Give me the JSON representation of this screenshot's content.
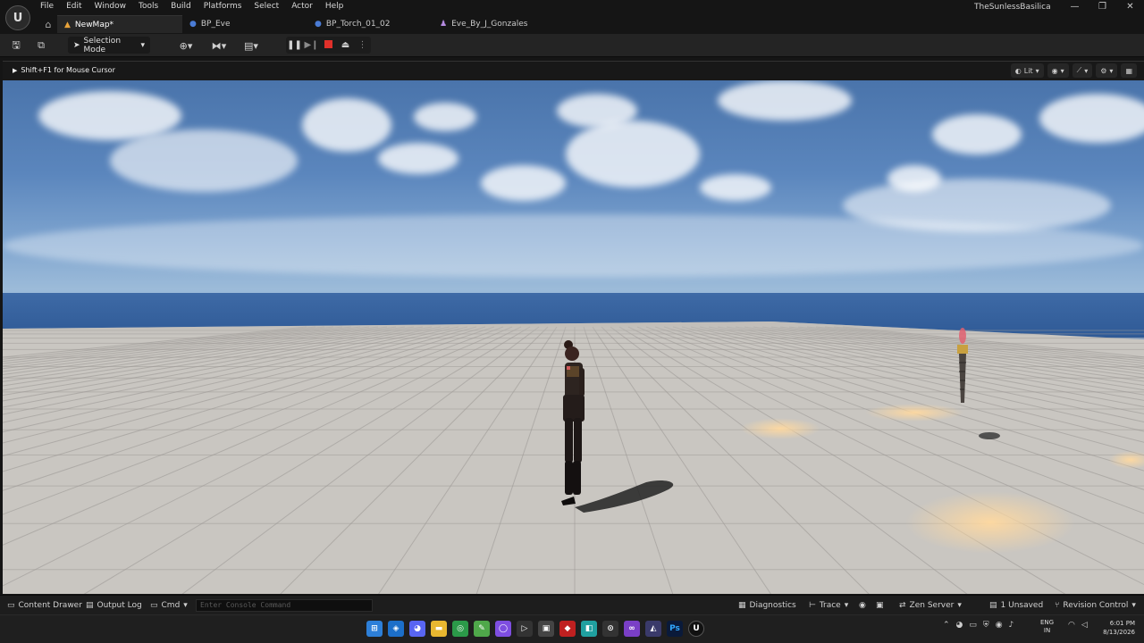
{
  "app": {
    "logo_letter": "U",
    "project_name": "TheSunlessBasilica",
    "window_controls": [
      "—",
      "❐",
      "✕"
    ]
  },
  "menu": [
    "File",
    "Edit",
    "Window",
    "Tools",
    "Build",
    "Platforms",
    "Select",
    "Actor",
    "Help"
  ],
  "tabs": [
    {
      "label": "NewMap*",
      "icon": "map-icon",
      "active": true
    },
    {
      "label": "BP_Eve",
      "icon": "blueprint-icon",
      "active": false
    },
    {
      "label": "BP_Torch_01_02",
      "icon": "blueprint-icon",
      "active": false
    },
    {
      "label": "Eve_By_J_Gonzales",
      "icon": "character-icon",
      "active": false
    }
  ],
  "toolbar": {
    "selection_mode": "Selection Mode"
  },
  "viewport": {
    "hint": "Shift+F1 for Mouse Cursor",
    "view_mode": "Lit"
  },
  "statusbar": {
    "content_drawer": "Content Drawer",
    "output_log": "Output Log",
    "cmd": "Cmd",
    "console_placeholder": "Enter Console Command",
    "diagnostics": "Diagnostics",
    "trace": "Trace",
    "zen_server": "Zen Server",
    "unsaved": "1 Unsaved",
    "revision_control": "Revision Control"
  },
  "taskbar": {
    "apps": [
      "windows-start-icon",
      "browser-icon",
      "discord-icon",
      "file-explorer-icon",
      "chrome-icon",
      "notepad-icon",
      "github-icon",
      "terminal-icon",
      "app-icon",
      "app-icon",
      "app-icon",
      "app-icon",
      "visual-studio-icon",
      "resolve-icon",
      "photoshop-icon",
      "unreal-icon"
    ],
    "app_labels": {
      "photoshop": "Ps",
      "unreal": "U"
    },
    "lang_line1": "ENG",
    "lang_line2": "IN",
    "time": "6:01 PM",
    "date": "8/13/2026"
  }
}
